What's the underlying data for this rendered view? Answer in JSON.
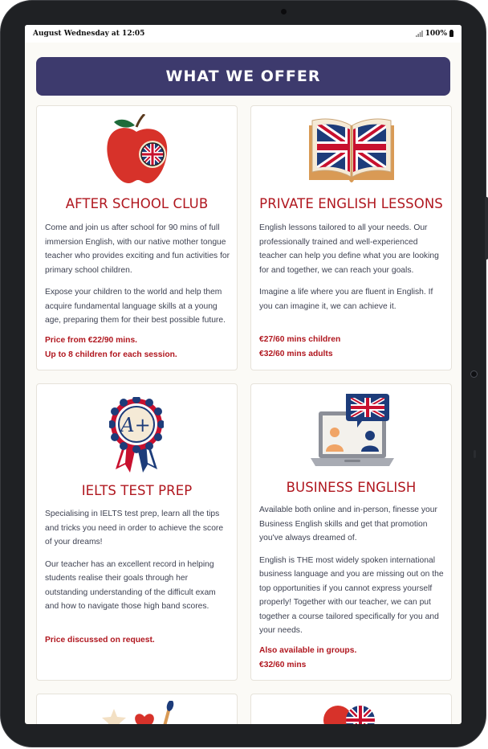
{
  "statusbar": {
    "time": "August Wednesday at 12:05",
    "battery": "100%"
  },
  "header": {
    "title": "WHAT WE OFFER"
  },
  "colors": {
    "header_bg": "#3d3a6d",
    "title_red": "#b0171f",
    "body_text": "#3e4252"
  },
  "cards": [
    {
      "icon": "apple-flag-icon",
      "title": "AFTER SCHOOL CLUB",
      "paragraphs": [
        "Come and join us after school for 90 mins of full immersion English, with our native mother tongue teacher who provides exciting and fun activities for primary school children.",
        "Expose your children to the world and help them acquire fundamental language skills at a young age, preparing them for their best possible future."
      ],
      "price_lines": [
        "Price from €22/90 mins.",
        "Up to 8 children for each session."
      ]
    },
    {
      "icon": "open-book-flag-icon",
      "title": "PRIVATE ENGLISH LESSONS",
      "paragraphs": [
        "English lessons tailored to all your needs. Our professionally trained and well-experienced teacher can help you define what you are looking for and together, we can reach your goals.",
        "Imagine a life where you are fluent in English. If you can imagine it, we can achieve it."
      ],
      "price_lines": [
        "€27/60 mins children",
        "€32/60 mins adults"
      ]
    },
    {
      "icon": "award-rosette-icon",
      "title": "IELTS TEST PREP",
      "paragraphs": [
        "Specialising in IELTS test prep, learn all the tips and tricks you need in order to achieve the score of your dreams!",
        "Our teacher has an excellent record in helping students realise their goals through her outstanding understanding of the difficult exam and how to navigate those high band scores."
      ],
      "price_lines": [
        "Price discussed on request."
      ]
    },
    {
      "icon": "laptop-video-call-icon",
      "title": "BUSINESS ENGLISH",
      "paragraphs": [
        "Available both online and in-person, finesse your Business English skills and get that promotion you've always dreamed of.",
        "English is THE most widely spoken international business language and you are missing out on the top opportunities if you cannot express yourself properly! Together with our teacher, we can put together a course tailored specifically for you and your needs."
      ],
      "price_lines": [
        "Also available in groups.",
        "€32/60 mins"
      ]
    }
  ],
  "partial_cards": [
    {
      "icon": "art-supplies-icon"
    },
    {
      "icon": "balloons-flag-icon"
    }
  ]
}
